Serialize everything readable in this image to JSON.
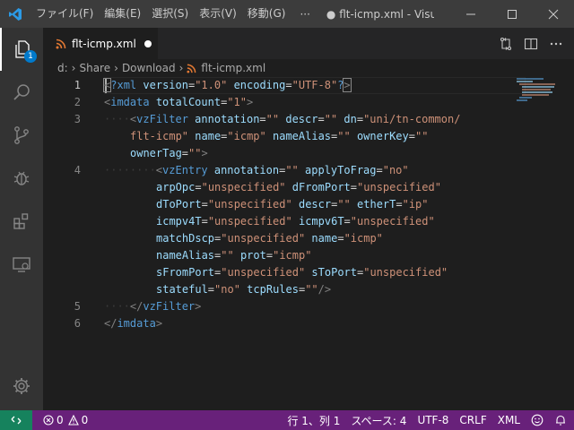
{
  "titlebar": {
    "menus": [
      "ファイル(F)",
      "編集(E)",
      "選択(S)",
      "表示(V)",
      "移動(G)"
    ],
    "more": "···",
    "title": "● flt-icmp.xml - Visu..."
  },
  "activity": {
    "explorer_badge": "1"
  },
  "tab": {
    "label": "flt-icmp.xml"
  },
  "breadcrumb": [
    "d:",
    "Share",
    "Download",
    "flt-icmp.xml"
  ],
  "editor": {
    "line_numbers": [
      "1",
      "2",
      "3",
      "4",
      "5",
      "6"
    ],
    "lines": {
      "l1": {
        "open": "<",
        "q1": "?",
        "tag": "xml",
        "a1": "version",
        "eq1": "=",
        "v1": "\"1.0\"",
        "a2": "encoding",
        "eq2": "=",
        "v2": "\"UTF-8\"",
        "q2": "?",
        "close": ">"
      },
      "l2": {
        "open": "<",
        "tag": "imdata",
        "a1": "totalCount",
        "eq1": "=",
        "v1": "\"1\"",
        "close": ">"
      },
      "l3a": {
        "ws": "····",
        "open": "<",
        "tag": "vzFilter",
        "a1": "annotation",
        "eq1": "=",
        "v1": "\"\"",
        "a2": "descr",
        "eq2": "=",
        "v2": "\"\"",
        "a3": "dn",
        "eq3": "=",
        "v3": "\"uni/tn-common/"
      },
      "l3b": {
        "v3": "flt-icmp\"",
        "a4": "name",
        "eq4": "=",
        "v4": "\"icmp\"",
        "a5": "nameAlias",
        "eq5": "=",
        "v5": "\"\"",
        "a6": "ownerKey",
        "eq6": "=",
        "v6": "\"\""
      },
      "l3c": {
        "a7": "ownerTag",
        "eq7": "=",
        "v7": "\"\"",
        "close": ">"
      },
      "l4a": {
        "ws": "········",
        "open": "<",
        "tag": "vzEntry",
        "a1": "annotation",
        "eq1": "=",
        "v1": "\"\"",
        "a2": "applyToFrag",
        "eq2": "=",
        "v2": "\"no\""
      },
      "l4b": {
        "a1": "arpOpc",
        "eq1": "=",
        "v1": "\"unspecified\"",
        "a2": "dFromPort",
        "eq2": "=",
        "v2": "\"unspecified\""
      },
      "l4c": {
        "a1": "dToPort",
        "eq1": "=",
        "v1": "\"unspecified\"",
        "a2": "descr",
        "eq2": "=",
        "v2": "\"\"",
        "a3": "etherT",
        "eq3": "=",
        "v3": "\"ip\""
      },
      "l4d": {
        "a1": "icmpv4T",
        "eq1": "=",
        "v1": "\"unspecified\"",
        "a2": "icmpv6T",
        "eq2": "=",
        "v2": "\"unspecified\""
      },
      "l4e": {
        "a1": "matchDscp",
        "eq1": "=",
        "v1": "\"unspecified\"",
        "a2": "name",
        "eq2": "=",
        "v2": "\"icmp\""
      },
      "l4f": {
        "a1": "nameAlias",
        "eq1": "=",
        "v1": "\"\"",
        "a2": "prot",
        "eq2": "=",
        "v2": "\"icmp\""
      },
      "l4g": {
        "a1": "sFromPort",
        "eq1": "=",
        "v1": "\"unspecified\"",
        "a2": "sToPort",
        "eq2": "=",
        "v2": "\"unspecified\""
      },
      "l4h": {
        "a1": "stateful",
        "eq1": "=",
        "v1": "\"no\"",
        "a2": "tcpRules",
        "eq2": "=",
        "v2": "\"\"",
        "close": "/>"
      },
      "l5": {
        "ws": "····",
        "open": "</",
        "tag": "vzFilter",
        "close": ">"
      },
      "l6": {
        "open": "</",
        "tag": "imdata",
        "close": ">"
      }
    }
  },
  "statusbar": {
    "errors": "0",
    "warnings": "0",
    "position": "行 1、列 1",
    "spaces": "スペース: 4",
    "encoding": "UTF-8",
    "eol": "CRLF",
    "language": "XML"
  },
  "colors": {
    "titlebar": "#3c3c3c",
    "activitybar": "#333333",
    "editor": "#1e1e1e",
    "statusbar": "#68217a",
    "remote": "#16825d",
    "accent": "#007acc",
    "tag": "#569cd6",
    "attribute": "#9cdcfe",
    "string": "#ce9178"
  }
}
